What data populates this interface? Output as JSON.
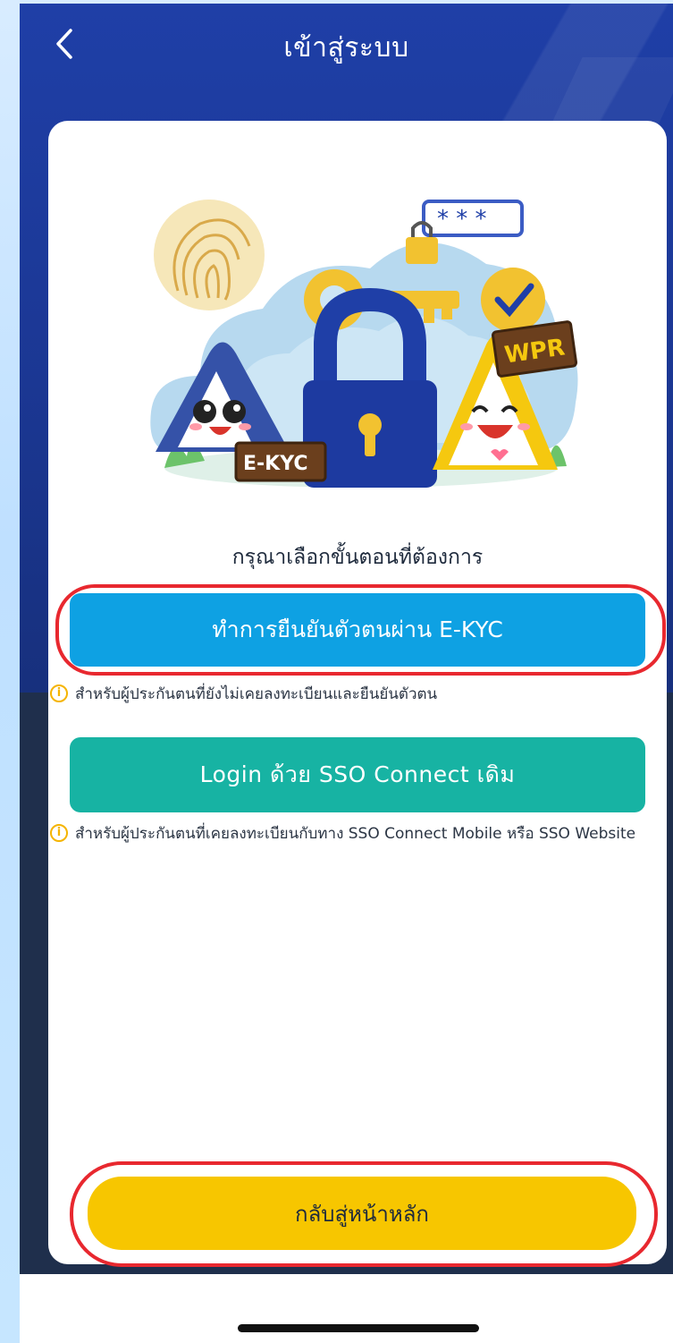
{
  "header": {
    "title": "เข้าสู่ระบบ",
    "back_icon": "chevron-left-icon"
  },
  "illustration": {
    "sign_left": "E-KYC",
    "sign_right": "WPR"
  },
  "main": {
    "prompt": "กรุณาเลือกขั้นตอนที่ต้องการ",
    "ekyc_button": "ทำการยืนยันตัวตนผ่าน E-KYC",
    "ekyc_note": "สำหรับผู้ประกันตนที่ยังไม่เคยลงทะเบียนและยืนยันตัวตน",
    "sso_button": "Login ด้วย SSO Connect เดิม",
    "sso_note": "สำหรับผู้ประกันตนที่เคยลงทะเบียนกับทาง SSO Connect Mobile หรือ SSO Website",
    "home_button": "กลับสู่หน้าหลัก"
  },
  "colors": {
    "header_blue": "#1f3fa7",
    "ekyc_blue": "#0ea1e3",
    "sso_teal": "#17b3a3",
    "home_yellow": "#f7c600",
    "highlight_red": "#e8282f",
    "info_yellow": "#f5b400"
  }
}
